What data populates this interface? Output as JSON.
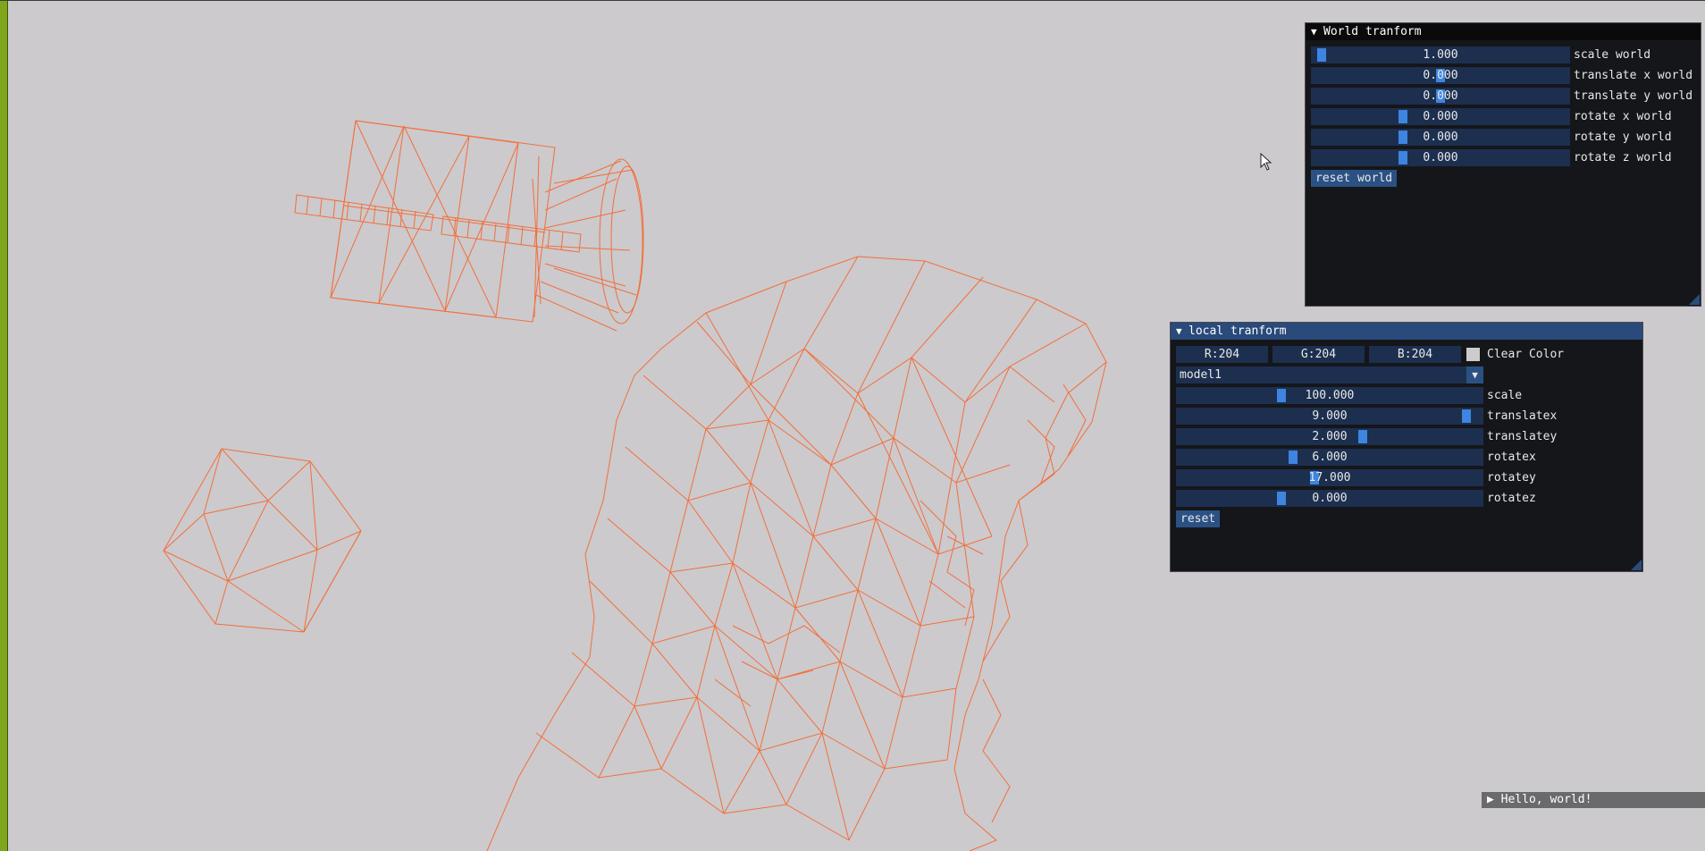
{
  "colors": {
    "background": "#cccacd",
    "wireframe": "#f26f3b",
    "accent": "#3d85e0",
    "frame": "#1d2f4f"
  },
  "world_window": {
    "title": "World tranform",
    "collapse_icon": "triangle-down-icon",
    "sliders": [
      {
        "value": "1.000",
        "label": "scale world",
        "fraction": 0.01
      },
      {
        "value": "0.000",
        "label": "translate x world",
        "fraction": 0.5
      },
      {
        "value": "0.000",
        "label": "translate y world",
        "fraction": 0.5
      },
      {
        "value": "0.000",
        "label": "rotate x world",
        "fraction": 0.35
      },
      {
        "value": "0.000",
        "label": "rotate y world",
        "fraction": 0.35
      },
      {
        "value": "0.000",
        "label": "rotate z world",
        "fraction": 0.35
      }
    ],
    "reset_label": "reset world"
  },
  "local_window": {
    "title": "local tranform",
    "collapse_icon": "triangle-down-icon",
    "color": {
      "r": "R:204",
      "g": "G:204",
      "b": "B:204",
      "label": "Clear Color",
      "swatch": "#cccccc"
    },
    "model_select": {
      "value": "model1",
      "icon": "triangle-down-icon"
    },
    "sliders": [
      {
        "value": "100.000",
        "label": "scale",
        "fraction": 0.33
      },
      {
        "value": "9.000",
        "label": "translatex",
        "fraction": 0.95
      },
      {
        "value": "2.000",
        "label": "translatey",
        "fraction": 0.6
      },
      {
        "value": "6.000",
        "label": "rotatex",
        "fraction": 0.37
      },
      {
        "value": "17.000",
        "label": "rotatey",
        "fraction": 0.45
      },
      {
        "value": "0.000",
        "label": "rotatez",
        "fraction": 0.33
      }
    ],
    "reset_label": "reset"
  },
  "hello_window": {
    "title": "Hello, world!",
    "icon": "triangle-right-icon"
  },
  "cursor_icon": "mouse-pointer-icon"
}
